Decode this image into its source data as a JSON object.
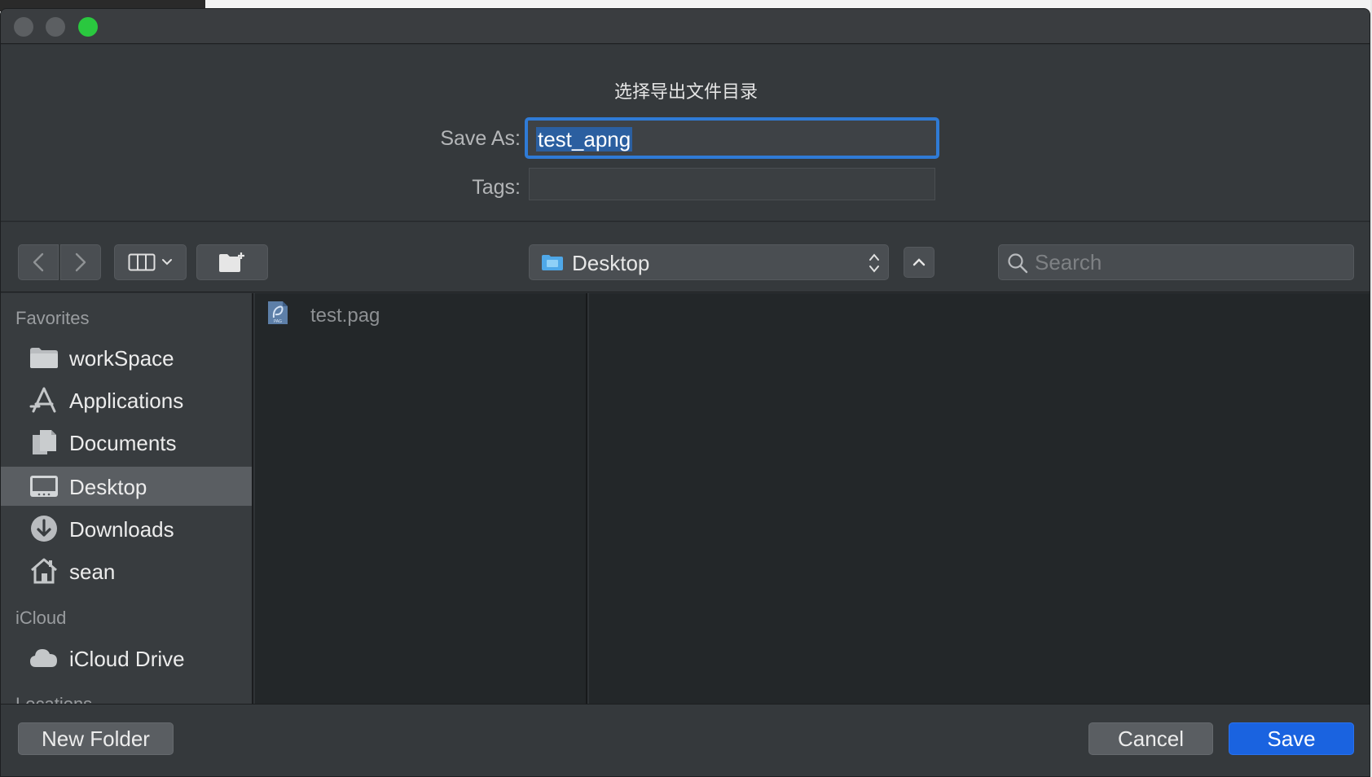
{
  "dialog": {
    "title": "选择导出文件目录",
    "save_as_label": "Save As:",
    "save_as_value": "test_apng",
    "tags_label": "Tags:"
  },
  "toolbar": {
    "location": "Desktop",
    "search_placeholder": "Search"
  },
  "sidebar": {
    "sections": [
      {
        "title": "Favorites",
        "items": [
          {
            "label": "workSpace",
            "icon": "folder-icon"
          },
          {
            "label": "Applications",
            "icon": "applications-icon"
          },
          {
            "label": "Documents",
            "icon": "documents-icon"
          },
          {
            "label": "Desktop",
            "icon": "desktop-icon",
            "selected": true
          },
          {
            "label": "Downloads",
            "icon": "downloads-icon"
          },
          {
            "label": "sean",
            "icon": "home-icon"
          }
        ]
      },
      {
        "title": "iCloud",
        "items": [
          {
            "label": "iCloud Drive",
            "icon": "cloud-icon"
          }
        ]
      },
      {
        "title": "Locations",
        "items": []
      }
    ]
  },
  "files": [
    {
      "name": "test.pag",
      "icon": "pag-file-icon",
      "dimmed": true
    }
  ],
  "footer": {
    "new_folder_label": "New Folder",
    "cancel_label": "Cancel",
    "save_label": "Save"
  },
  "colors": {
    "accent": "#2f7bd6",
    "save_button": "#1a63e0",
    "maximize": "#2ac83f"
  }
}
